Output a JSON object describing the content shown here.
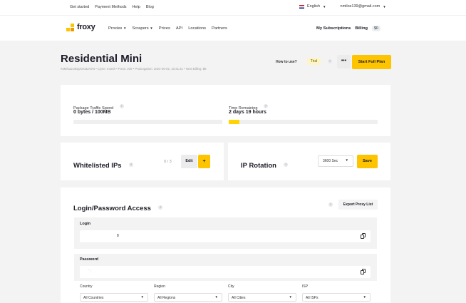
{
  "topbar": {
    "links": [
      "Get started",
      "Payment Methods",
      "Help",
      "Blog"
    ],
    "language": "English",
    "email": "nmilos139@gmail.com"
  },
  "navbar": {
    "logo": "froxy",
    "items": [
      "Proxies",
      "Scrapers",
      "Prices",
      "API",
      "Locations",
      "Partners"
    ],
    "my_subscriptions": "My Subscriptions",
    "billing": "Billing",
    "billing_badge": "$0"
  },
  "header": {
    "title": "Residential Mini",
    "meta": "#3Mfoa2UBQ2GN3ZVeN  •  Cycle: month  •  Ports: 200  •  Prolongation: 2024-05-02, 10:31:31  •  Next Billing: $8",
    "how_to_use": "How to use?",
    "trial_badge": "Trial",
    "more_label": "•••",
    "start_full_plan": "Start Full Plan"
  },
  "usage": {
    "traffic_label": "Package Traffic Spend",
    "traffic_value": "0 bytes / 100MB",
    "traffic_progress": 0,
    "time_label": "Time Remaining",
    "time_value": "2 days 19 hours",
    "time_progress": 0.07
  },
  "whitelist": {
    "title": "Whitelisted IPs",
    "count": "0 / 3",
    "edit_label": "Edit",
    "add_label": "+"
  },
  "rotation": {
    "title": "IP Rotation",
    "interval": "3600 Sec",
    "save_label": "Save"
  },
  "access": {
    "title": "Login/Password Access",
    "export_label": "Export Proxy List",
    "login_label": "Login",
    "login_value": "8",
    "password_label": "Password",
    "password_value": "` :",
    "filters": [
      {
        "label": "Country",
        "value": "All Countries"
      },
      {
        "label": "Region",
        "value": "All Regions"
      },
      {
        "label": "City",
        "value": "All Cities"
      },
      {
        "label": "ISP",
        "value": "All ISPs"
      }
    ]
  },
  "colors": {
    "accent": "#ffc400",
    "background": "#f3f3f3"
  }
}
